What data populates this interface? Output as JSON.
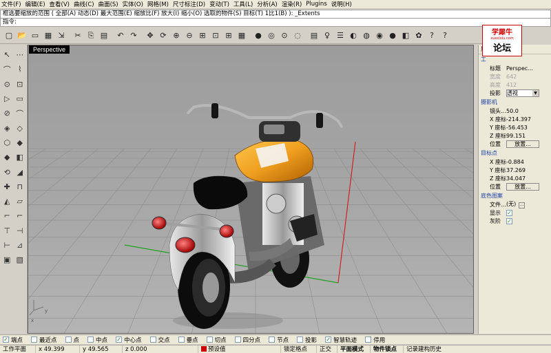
{
  "menu": [
    "文件(F)",
    "编辑(E)",
    "查看(V)",
    "曲线(C)",
    "曲面(S)",
    "实体(O)",
    "网格(M)",
    "尺寸标注(D)",
    "变动(T)",
    "工具(L)",
    "分析(A)",
    "渲染(R)",
    "Plugins",
    "说明(H)"
  ],
  "command_history": "框选要缩放的范围 ( 全部(A)  动态(D)  最大范围(E)  缩放比(F)  放大(I)  缩小(O)  选取的物件(S)  目标(T)  1比1(B) ): _Extents",
  "command_prompt": "指令:",
  "toolbar_icons": [
    "new-file-icon",
    "open-folder-icon",
    "save-icon",
    "print-icon",
    "import-icon",
    "cut-icon",
    "copy-icon",
    "paste-icon",
    "undo-icon",
    "redo-icon",
    "pan-icon",
    "rotate-view-icon",
    "zoom-window-icon",
    "zoom-dynamic-icon",
    "zoom-extents-icon",
    "zoom-selected-icon",
    "four-viewports-icon",
    "grid-icon",
    "car-icon",
    "hide-icon",
    "snap-icon",
    "camera-icon",
    "layer-icon",
    "light-icon",
    "props-icon",
    "render-icon",
    "options-icon",
    "material-icon",
    "sphere-icon",
    "texture-icon",
    "gear-icon",
    "cursor-help-icon",
    "help-icon"
  ],
  "toolbar_glyphs": [
    "▢",
    "📂",
    "▭",
    "▦",
    "⇲",
    "✂",
    "⎘",
    "▤",
    "↶",
    "↷",
    "✥",
    "⟳",
    "⊕",
    "⊖",
    "⊞",
    "⊡",
    "⊞",
    "▦",
    "●",
    "◎",
    "⊙",
    "◌",
    "▤",
    "♀",
    "☰",
    "◐",
    "◍",
    "◉",
    "●",
    "◧",
    "✿",
    "?",
    "?"
  ],
  "left_tools": [
    [
      "↖",
      "⋯"
    ],
    [
      "⌒",
      "⌇"
    ],
    [
      "⊙",
      "⊡"
    ],
    [
      "▷",
      "▭"
    ],
    [
      "⊘",
      "⌒"
    ],
    [
      "◈",
      "◇"
    ],
    [
      "⬡",
      "◆"
    ],
    [
      "◆",
      "◧"
    ],
    [
      "⟲",
      "◢"
    ],
    [
      "✚",
      "⊓"
    ],
    [
      "◭",
      "▱"
    ],
    [
      "⌐",
      "⌐"
    ],
    [
      "⊤",
      "⊣"
    ],
    [
      "⊢",
      "⊿"
    ],
    [
      "▣",
      "▧"
    ]
  ],
  "viewport": {
    "title": "Perspective"
  },
  "logo": {
    "line1": "学犀牛",
    "line2": "xuexiniu.com",
    "line3": "论坛"
  },
  "panel": {
    "title": "属",
    "sections": {
      "view": "工",
      "camera": "摄影机",
      "target": "目标点",
      "wallpaper": "底色图案"
    },
    "rows": {
      "title_label": "标题",
      "title_value": "Perspec...",
      "width_label": "宽度",
      "width_value": "642",
      "height_label": "高度",
      "height_value": "412",
      "projection_label": "投影",
      "projection_value": "透视",
      "lens_label": "镜头...",
      "lens_value": "50.0",
      "cam_x_label": "X 座标",
      "cam_x_value": "-214.397",
      "cam_y_label": "Y 座标",
      "cam_y_value": "-56.453",
      "cam_z_label": "Z 座标",
      "cam_z_value": "99.151",
      "cam_pos_label": "位置",
      "cam_pos_button": "放置...",
      "tgt_x_label": "X 座标",
      "tgt_x_value": "-0.884",
      "tgt_y_label": "Y 座标",
      "tgt_y_value": "37.269",
      "tgt_z_label": "Z 座标",
      "tgt_z_value": "34.047",
      "tgt_pos_label": "位置",
      "tgt_pos_button": "放置...",
      "file_label": "文件...",
      "file_value": "(无)",
      "show_label": "显示",
      "gray_label": "灰阶"
    }
  },
  "osnaps": [
    {
      "label": "端点",
      "checked": true
    },
    {
      "label": "最近点",
      "checked": false
    },
    {
      "label": "点",
      "checked": false
    },
    {
      "label": "中点",
      "checked": false
    },
    {
      "label": "中心点",
      "checked": true
    },
    {
      "label": "交点",
      "checked": false
    },
    {
      "label": "垂点",
      "checked": false
    },
    {
      "label": "切点",
      "checked": false
    },
    {
      "label": "四分点",
      "checked": false
    },
    {
      "label": "节点",
      "checked": false
    },
    {
      "label": "投影",
      "checked": false
    },
    {
      "label": "智慧轨迹",
      "checked": true
    },
    {
      "label": "停用",
      "checked": false
    }
  ],
  "status": {
    "cplane": "工作平面",
    "x": "x 49.399",
    "y": "y 49.565",
    "z": "z 0.000",
    "layer": "预设值",
    "lock_grid": "锁定格点",
    "ortho": "正交",
    "planar": "平面模式",
    "osnap": "物件锁点",
    "history": "记录建构历史"
  },
  "colors": {
    "accent": "#1a3fa6",
    "layer_swatch": "#cc0000",
    "tank": "#f0a020",
    "viewport_bg": "#a4a4a4"
  }
}
